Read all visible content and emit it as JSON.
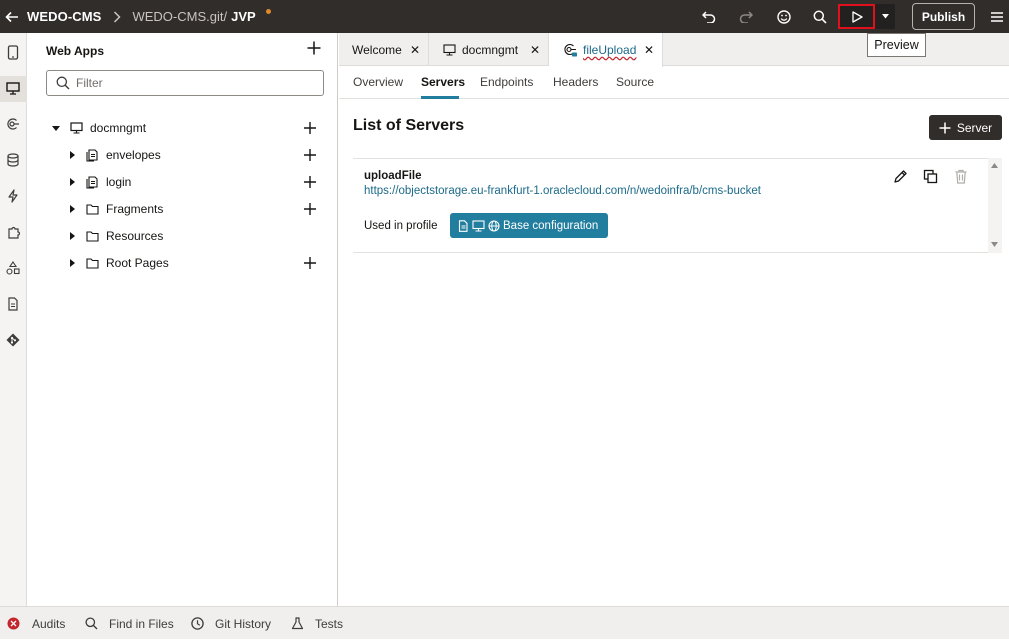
{
  "topbar": {
    "project": "WEDO-CMS",
    "repo": "WEDO-CMS.git/",
    "branch": "JVP",
    "publish_label": "Publish",
    "tooltip": "Preview",
    "icons": [
      "back-arrow-icon",
      "chevron-right-icon",
      "undo-icon",
      "redo-icon",
      "smiley-feedback-icon",
      "search-icon",
      "play-preview-icon",
      "caret-down-icon",
      "hamburger-menu-icon"
    ],
    "colors": {
      "bar": "#312d2a",
      "dirty_dot": "#e0892a",
      "highlight": "#e0101c"
    }
  },
  "rail": {
    "icons": [
      "device-mobile-icon",
      "monitor-icon",
      "api-endpoint-icon",
      "database-icon",
      "lightning-icon",
      "puzzle-icon",
      "shapes-icon",
      "document-icon",
      "git-icon"
    ]
  },
  "explorer": {
    "title": "Web Apps",
    "filter_placeholder": "Filter",
    "tree": [
      {
        "label": "docmngmt",
        "icon": "monitor-icon",
        "expanded": true,
        "level": 0,
        "add": true
      },
      {
        "label": "envelopes",
        "icon": "document-stack-icon",
        "expanded": false,
        "level": 1,
        "add": true
      },
      {
        "label": "login",
        "icon": "document-stack-icon",
        "expanded": false,
        "level": 1,
        "add": true
      },
      {
        "label": "Fragments",
        "icon": "folder-icon",
        "expanded": false,
        "level": 1,
        "add": true
      },
      {
        "label": "Resources",
        "icon": "folder-icon",
        "expanded": false,
        "level": 1,
        "add": false
      },
      {
        "label": "Root Pages",
        "icon": "folder-icon",
        "expanded": false,
        "level": 1,
        "add": true
      }
    ]
  },
  "tabs": [
    {
      "label": "Welcome",
      "icon": "",
      "active": false
    },
    {
      "label": "docmngmt",
      "icon": "monitor-icon",
      "active": false
    },
    {
      "label": "fileUpload",
      "icon": "api-endpoint-icon",
      "active": true
    }
  ],
  "subnav": {
    "items": [
      "Overview",
      "Servers",
      "Endpoints",
      "Headers",
      "Source"
    ],
    "active": "Servers"
  },
  "main": {
    "title": "List of Servers",
    "add_server_label": "Server",
    "servers": [
      {
        "name": "uploadFile",
        "url": "https://objectstorage.eu-frankfurt-1.oraclecloud.com/n/wedoinfra/b/cms-bucket",
        "used_in_label": "Used in profile",
        "profile_label": "Base configuration",
        "profile_icons": [
          "document-icon",
          "monitor-icon",
          "globe-icon"
        ],
        "actions": [
          "edit-pencil-icon",
          "duplicate-icon",
          "trash-icon"
        ]
      }
    ],
    "colors": {
      "accent": "#227e9e",
      "link": "#1c6a8a"
    }
  },
  "statusbar": {
    "items": [
      {
        "label": "Audits",
        "icon": "error-circle-icon"
      },
      {
        "label": "Find in Files",
        "icon": "search-icon"
      },
      {
        "label": "Git History",
        "icon": "clock-icon"
      },
      {
        "label": "Tests",
        "icon": "flask-icon"
      }
    ]
  }
}
